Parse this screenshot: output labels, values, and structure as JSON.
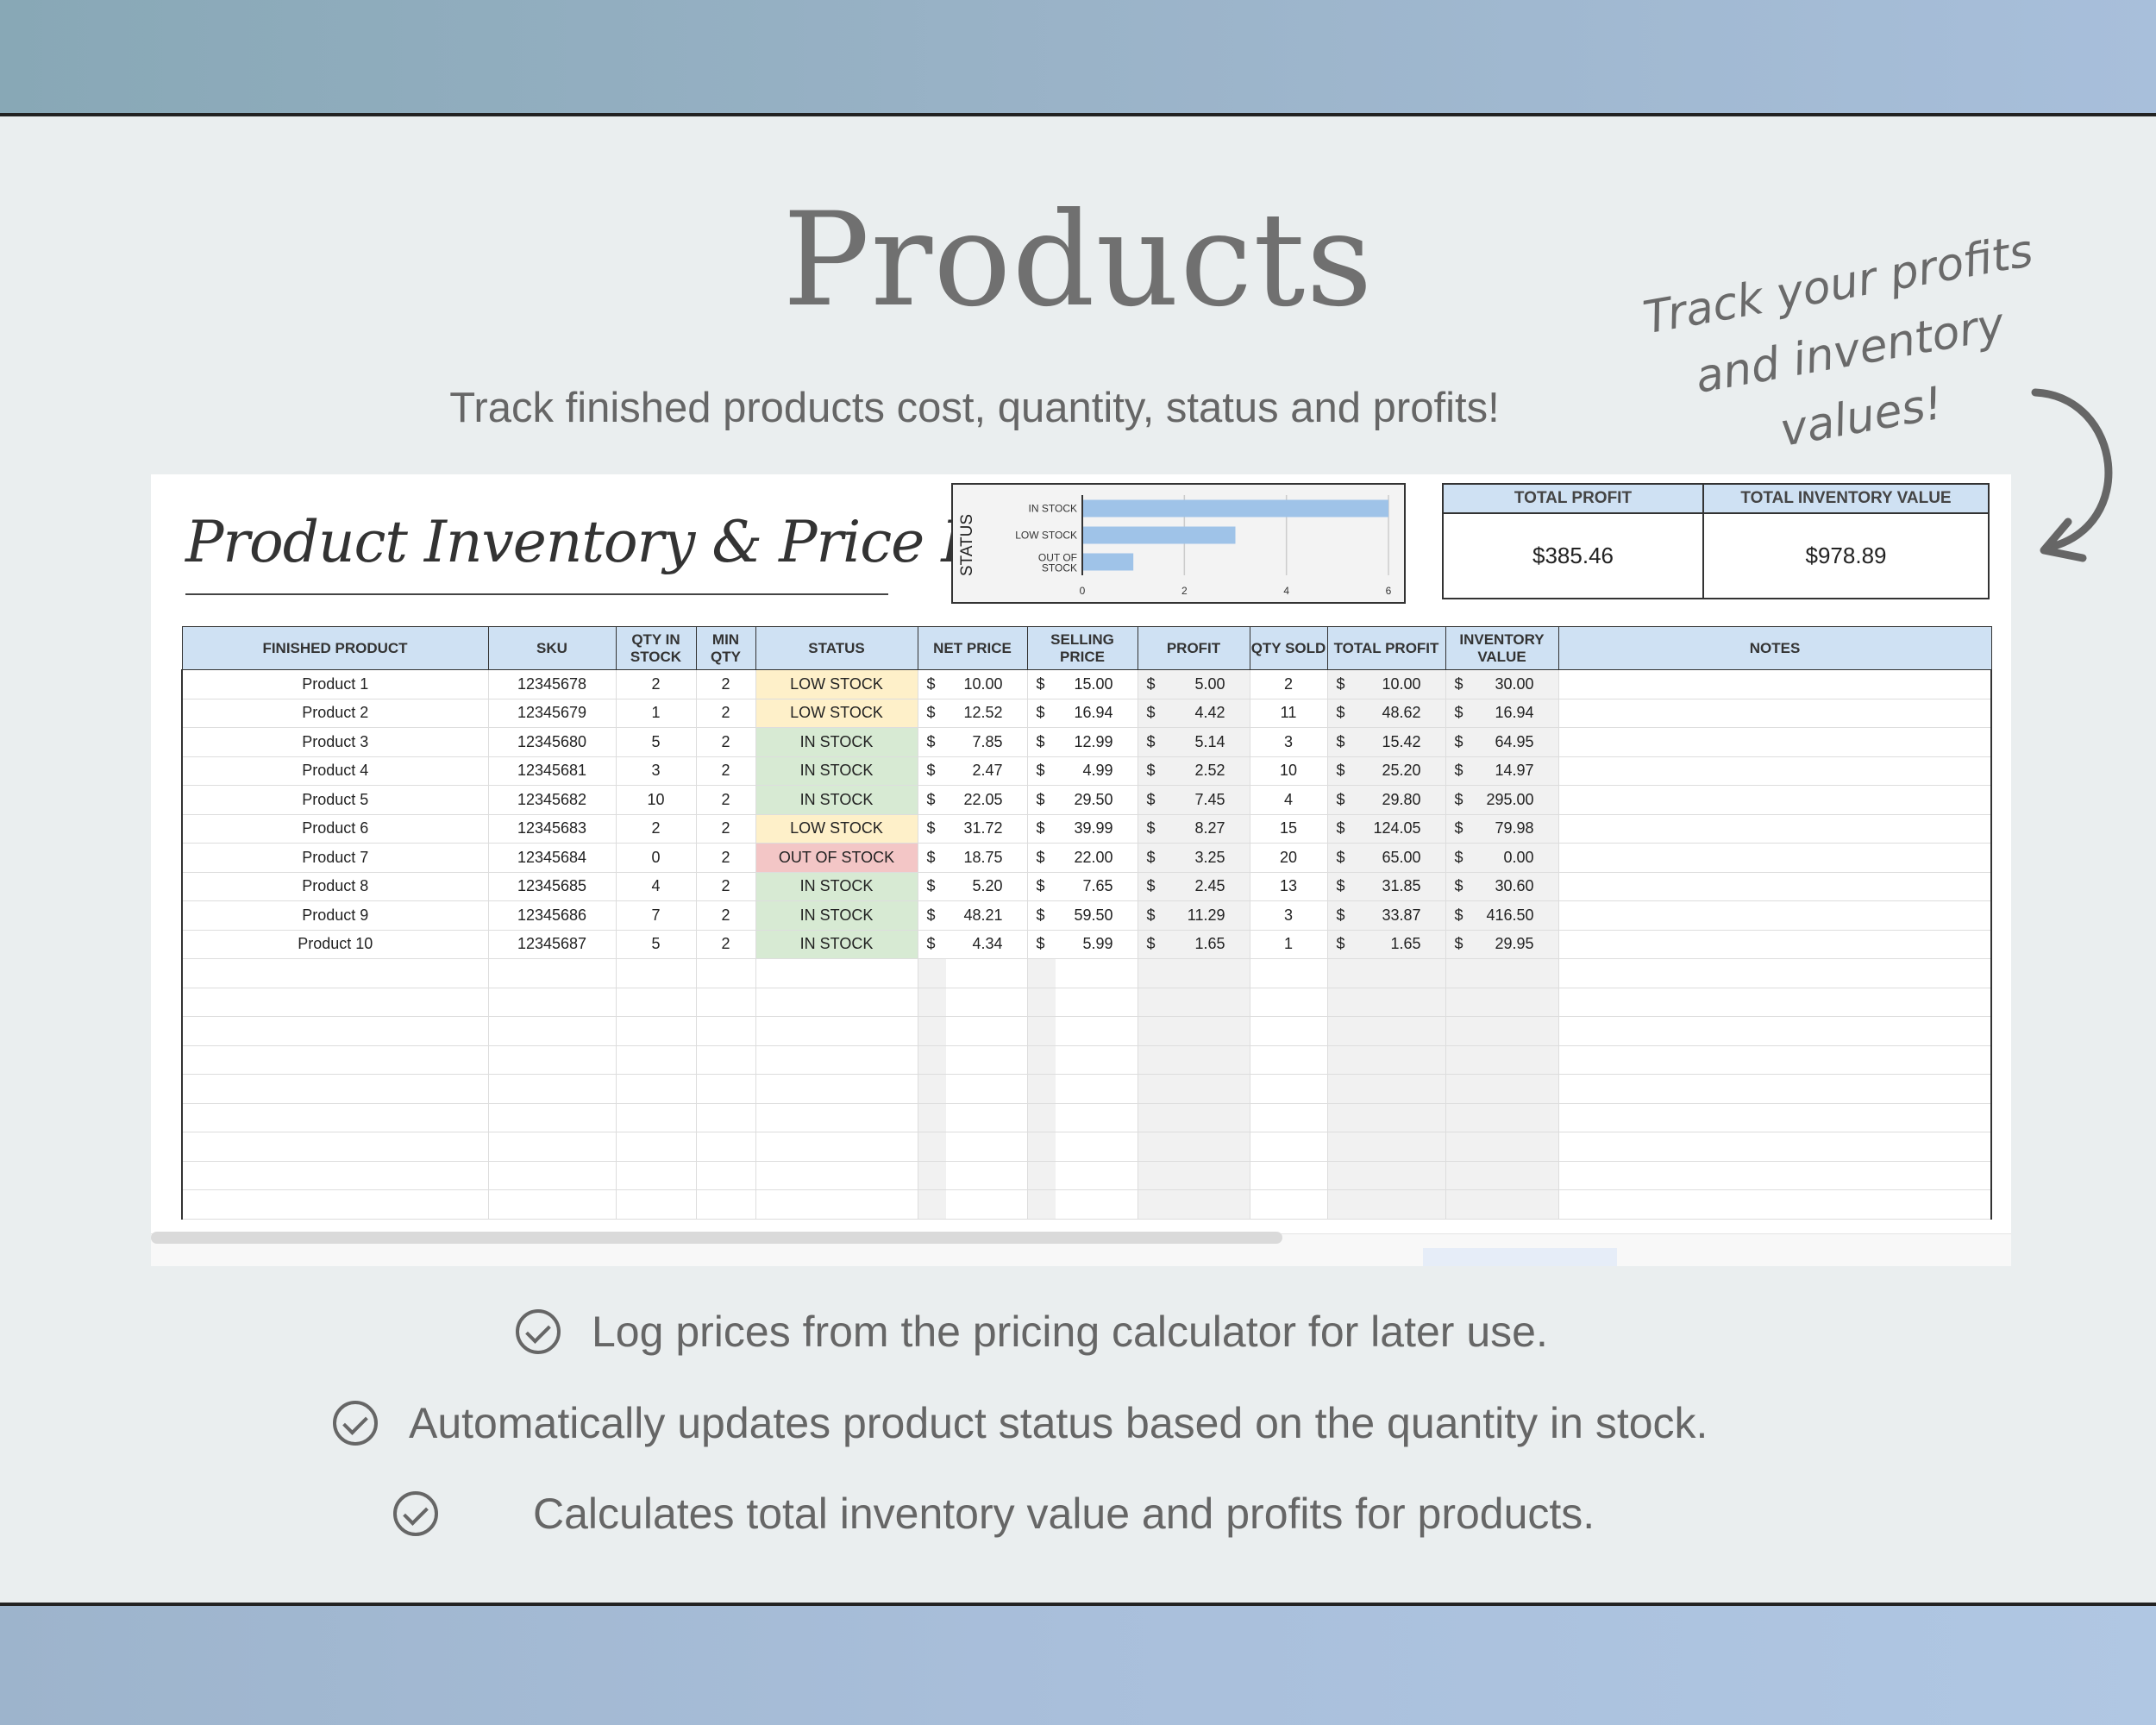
{
  "page": {
    "title": "Products",
    "subtitle": "Track finished products cost, quantity, status and profits!",
    "hand_note": "Track your profits and inventory values!",
    "colors": {
      "band": "#9ab3c8",
      "header_fill": "#cfe1f3",
      "low_stock": "#fef0c9",
      "in_stock": "#d7ead3",
      "out_of_stock": "#f3c6c6",
      "bar": "#9fc3e8"
    }
  },
  "sheet": {
    "title": "Product Inventory & Price List",
    "totals": {
      "profit_label": "TOTAL PROFIT",
      "profit_value": "$385.46",
      "inventory_label": "TOTAL INVENTORY VALUE",
      "inventory_value": "$978.89"
    },
    "columns": [
      "FINISHED PRODUCT",
      "SKU",
      "QTY IN STOCK",
      "MIN QTY",
      "STATUS",
      "NET PRICE",
      "SELLING PRICE",
      "PROFIT",
      "QTY SOLD",
      "TOTAL PROFIT",
      "INVENTORY VALUE",
      "NOTES"
    ],
    "currency_symbol": "$",
    "rows": [
      {
        "product": "Product 1",
        "sku": "12345678",
        "qty": "2",
        "min": "2",
        "status": "LOW STOCK",
        "net": "10.00",
        "sell": "15.00",
        "profit": "5.00",
        "sold": "2",
        "total": "10.00",
        "inv": "30.00",
        "notes": ""
      },
      {
        "product": "Product 2",
        "sku": "12345679",
        "qty": "1",
        "min": "2",
        "status": "LOW STOCK",
        "net": "12.52",
        "sell": "16.94",
        "profit": "4.42",
        "sold": "11",
        "total": "48.62",
        "inv": "16.94",
        "notes": ""
      },
      {
        "product": "Product 3",
        "sku": "12345680",
        "qty": "5",
        "min": "2",
        "status": "IN STOCK",
        "net": "7.85",
        "sell": "12.99",
        "profit": "5.14",
        "sold": "3",
        "total": "15.42",
        "inv": "64.95",
        "notes": ""
      },
      {
        "product": "Product 4",
        "sku": "12345681",
        "qty": "3",
        "min": "2",
        "status": "IN STOCK",
        "net": "2.47",
        "sell": "4.99",
        "profit": "2.52",
        "sold": "10",
        "total": "25.20",
        "inv": "14.97",
        "notes": ""
      },
      {
        "product": "Product 5",
        "sku": "12345682",
        "qty": "10",
        "min": "2",
        "status": "IN STOCK",
        "net": "22.05",
        "sell": "29.50",
        "profit": "7.45",
        "sold": "4",
        "total": "29.80",
        "inv": "295.00",
        "notes": ""
      },
      {
        "product": "Product 6",
        "sku": "12345683",
        "qty": "2",
        "min": "2",
        "status": "LOW STOCK",
        "net": "31.72",
        "sell": "39.99",
        "profit": "8.27",
        "sold": "15",
        "total": "124.05",
        "inv": "79.98",
        "notes": ""
      },
      {
        "product": "Product 7",
        "sku": "12345684",
        "qty": "0",
        "min": "2",
        "status": "OUT OF STOCK",
        "net": "18.75",
        "sell": "22.00",
        "profit": "3.25",
        "sold": "20",
        "total": "65.00",
        "inv": "0.00",
        "notes": ""
      },
      {
        "product": "Product 8",
        "sku": "12345685",
        "qty": "4",
        "min": "2",
        "status": "IN STOCK",
        "net": "5.20",
        "sell": "7.65",
        "profit": "2.45",
        "sold": "13",
        "total": "31.85",
        "inv": "30.60",
        "notes": ""
      },
      {
        "product": "Product 9",
        "sku": "12345686",
        "qty": "7",
        "min": "2",
        "status": "IN STOCK",
        "net": "48.21",
        "sell": "59.50",
        "profit": "11.29",
        "sold": "3",
        "total": "33.87",
        "inv": "416.50",
        "notes": ""
      },
      {
        "product": "Product 10",
        "sku": "12345687",
        "qty": "5",
        "min": "2",
        "status": "IN STOCK",
        "net": "4.34",
        "sell": "5.99",
        "profit": "1.65",
        "sold": "1",
        "total": "1.65",
        "inv": "29.95",
        "notes": ""
      }
    ]
  },
  "chart_data": {
    "type": "bar",
    "orientation": "horizontal",
    "ylabel": "STATUS",
    "categories": [
      "IN STOCK",
      "LOW STOCK",
      "OUT OF STOCK"
    ],
    "values": [
      6,
      3,
      1
    ],
    "xlim": [
      0,
      6
    ],
    "xticks": [
      "0",
      "2",
      "4",
      "6"
    ],
    "grid": true
  },
  "bullets": [
    "Log prices from the pricing calculator for later use.",
    "Automatically updates product status based on the quantity in stock.",
    "Calculates total inventory value and profits for products."
  ]
}
